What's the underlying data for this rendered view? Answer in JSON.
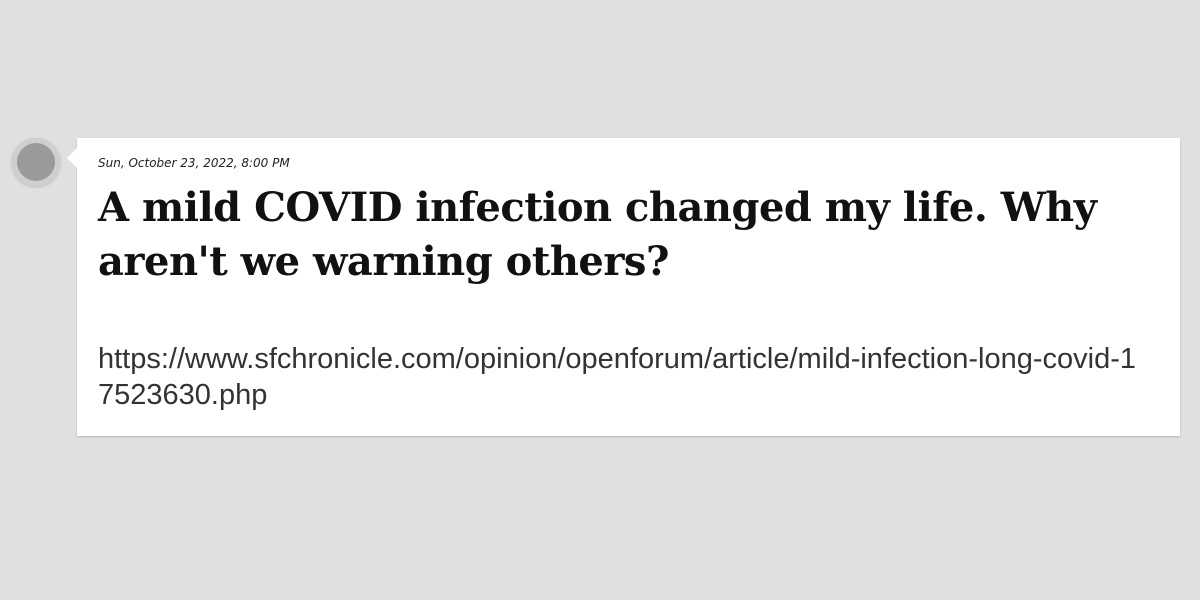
{
  "post": {
    "timestamp": "Sun, October 23, 2022, 8:00 PM",
    "headline": "A mild COVID infection changed my life. Why aren't we warning others?",
    "url": "https://www.sfchronicle.com/opinion/openforum/article/mild-infection-long-covid-17523630.php"
  },
  "colors": {
    "background": "#e0e0e0",
    "card": "#ffffff",
    "avatar": "#9a9a9a",
    "headline_text": "#111111",
    "url_text": "#333333"
  },
  "icons": {
    "avatar": "avatar-circle-icon"
  }
}
